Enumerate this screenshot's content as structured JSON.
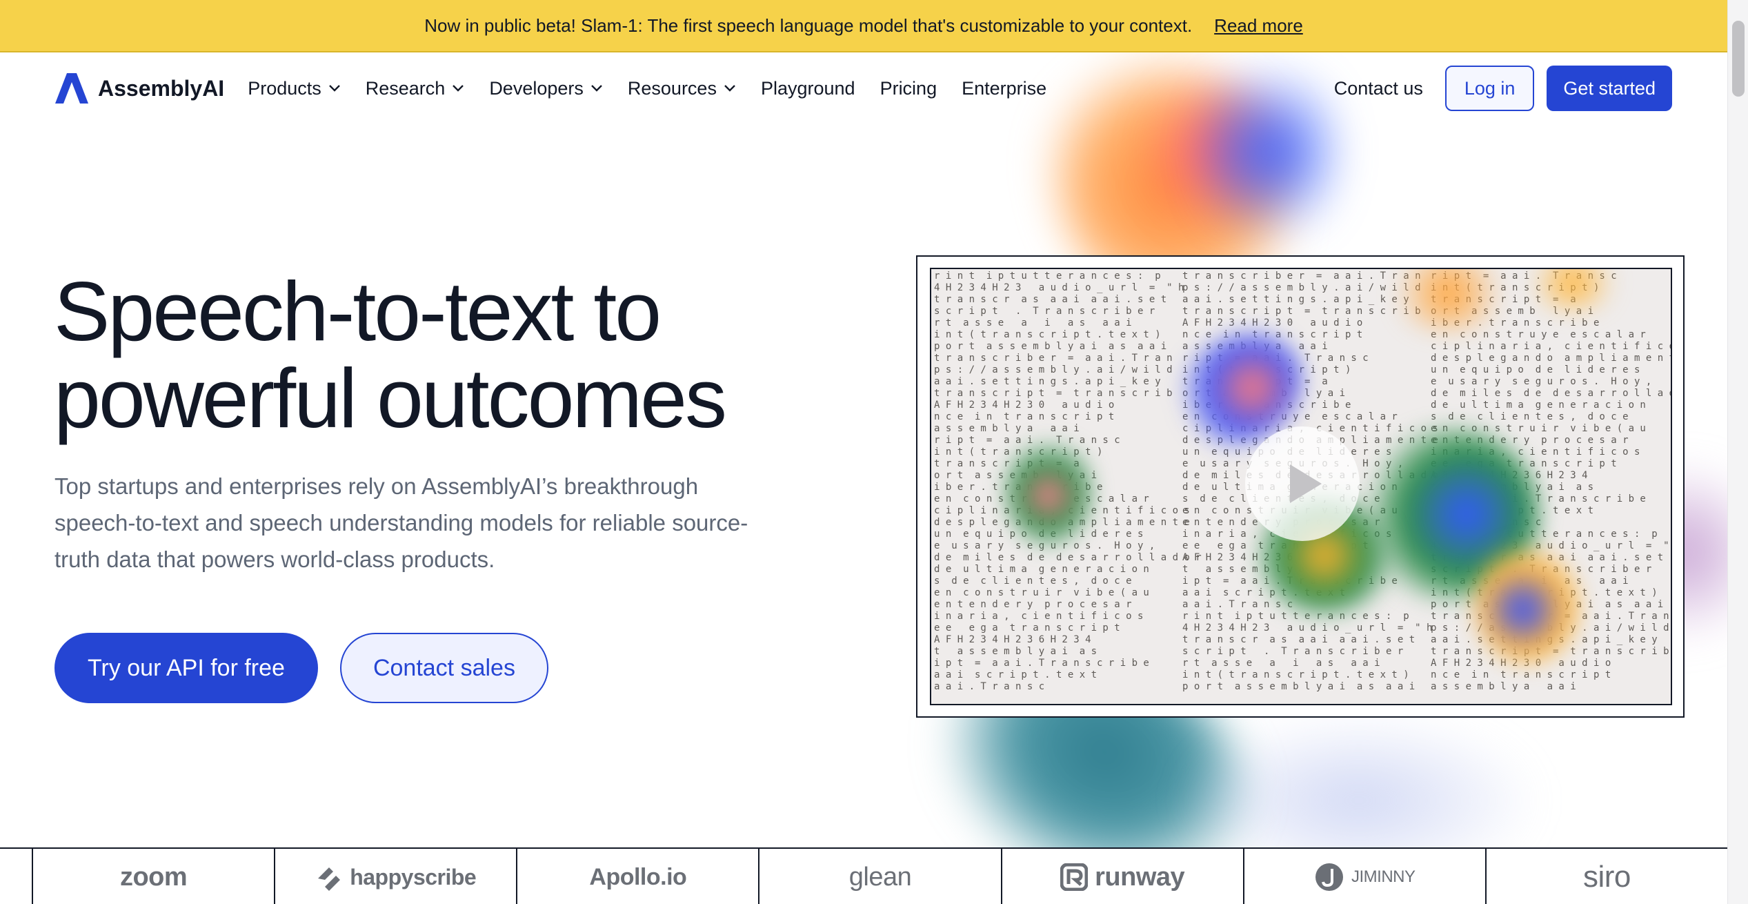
{
  "announcement": {
    "text": "Now in public beta! Slam-1: The first speech language model that's customizable to your context.",
    "link": "Read more"
  },
  "brand": {
    "name": "AssemblyAI",
    "accent": "#2545d3",
    "banner_color": "#f6d24a"
  },
  "nav": {
    "items": [
      {
        "label": "Products",
        "has_dropdown": true
      },
      {
        "label": "Research",
        "has_dropdown": true
      },
      {
        "label": "Developers",
        "has_dropdown": true
      },
      {
        "label": "Resources",
        "has_dropdown": true
      },
      {
        "label": "Playground",
        "has_dropdown": false
      },
      {
        "label": "Pricing",
        "has_dropdown": false
      },
      {
        "label": "Enterprise",
        "has_dropdown": false
      }
    ],
    "contact": "Contact us",
    "login": "Log in",
    "get_started": "Get started"
  },
  "hero": {
    "title_line1": "Speech-to-text to",
    "title_line2": "powerful outcomes",
    "subtitle": "Top startups and enterprises rely on AssemblyAI’s breakthrough speech-to-text and speech understanding models for reliable source-truth data that powers world-class products.",
    "cta_primary": "Try our API for free",
    "cta_secondary": "Contact sales"
  },
  "video": {
    "play_icon": "play-icon",
    "code_lines": [
      "r i n t  i p t u t t e r a n c e s :  p",
      "4 H 2 3 4 H 2 3   a u d i o _ u r l  =  \" h",
      "t r a n s c r  a s  a a i  a a i . s e t",
      "s c r i p t   .  T r a n s c r i b e r",
      "r t  a s s e   a   i   a s   a a i",
      "i n t ( t r a n s c r i p t . t e x t )",
      "p o r t  a s s e m b l y a i  a s  a a i",
      "t r a n s c r i b e r  =  a a i . T r a n",
      "p s : / / a s s e m b l y . a i / w i l d",
      "a a i . s e t t i n g s . a p i _ k e y",
      "t r a n s c r i p t  =  t r a n s c r i b",
      "A F H 2 3 4 H 2 3 0   a u d i o",
      "n c e  i n  t r a n s c r i p t",
      "a s s e m b l y a   a a i",
      "r i p t  =  a a i .  T r a n s c",
      "i n t ( t r a n s c r i p t )",
      "t r a n s c r i p t  =  a",
      "o r t  a s s e m b   l y a i",
      "i b e r . t r a n s c r i b e",
      "e n  c o n s t r u y e  e s c a l a r",
      "c i p l i n a r i a ,  c i e n t i f i c o s",
      "d e s p l e g a n d o  a m p l i a m e n t e",
      "u n  e q u i p o  d e  l i d e r e s",
      "e  u s a r y  s e g u r o s .  H o y ,",
      "d e  m i l e s  d e  d e s a r r o l l a d o r",
      "d e  u l t i m a  g e n e r a c i o n",
      "s  d e  c l i e n t e s ,  d o c e",
      "e n  c o n s t r u i r  v i b e ( a u",
      "e n t e n d e r y  p r o c e s a r",
      "i n a r i a ,  c i e n t i f i c o s",
      "e e   e g a  t r a n s c r i p t",
      "A F H 2 3 4 H 2 3 6 H 2 3 4",
      "t   a s s e m b l y a i  a s",
      "i p t  =  a a i . T r a n s c r i b e",
      "a a i  s c r i p t . t e x t",
      "a a i . T r a n s c"
    ]
  },
  "logos": [
    "zoom",
    "happyscribe",
    "Apollo.io",
    "glean",
    "runway",
    "JIMINNY",
    "siro"
  ]
}
